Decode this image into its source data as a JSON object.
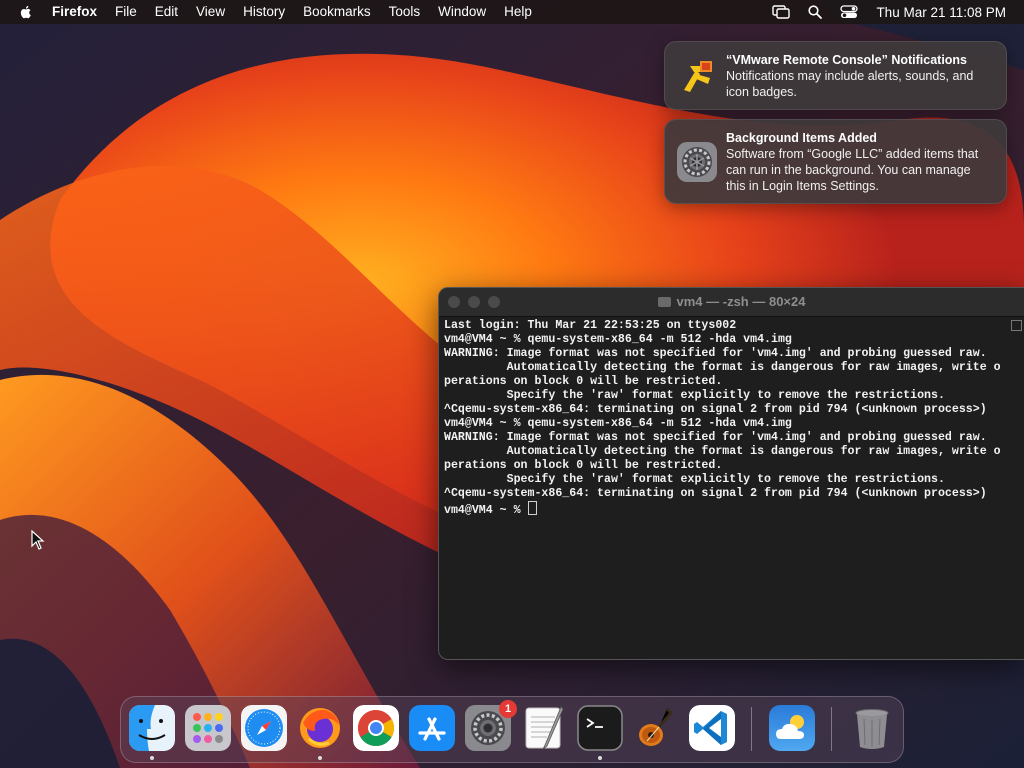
{
  "menubar": {
    "app_name": "Firefox",
    "items": [
      "File",
      "Edit",
      "View",
      "History",
      "Bookmarks",
      "Tools",
      "Window",
      "Help"
    ],
    "clock": "Thu Mar 21  11:08 PM",
    "status_icons": [
      "screen-mirroring-icon",
      "spotlight-search-icon",
      "control-center-icon"
    ]
  },
  "notifications": [
    {
      "title": "“VMware Remote Console” Notifications",
      "body": "Notifications may include alerts, sounds, and icon badges.",
      "icon": "vmware-remote-console-icon"
    },
    {
      "title": "Background Items Added",
      "body": "Software from “Google LLC” added items that can run in the background. You can manage this in Login Items Settings.",
      "icon": "system-settings-gear-icon"
    }
  ],
  "terminal": {
    "title": "vm4 — -zsh — 80×24",
    "lines": [
      "Last login: Thu Mar 21 22:53:25 on ttys002",
      "vm4@VM4 ~ % qemu-system-x86_64 -m 512 -hda vm4.img",
      "WARNING: Image format was not specified for 'vm4.img' and probing guessed raw.",
      "         Automatically detecting the format is dangerous for raw images, write o",
      "perations on block 0 will be restricted.",
      "         Specify the 'raw' format explicitly to remove the restrictions.",
      "^Cqemu-system-x86_64: terminating on signal 2 from pid 794 (<unknown process>)",
      "vm4@VM4 ~ % qemu-system-x86_64 -m 512 -hda vm4.img",
      "WARNING: Image format was not specified for 'vm4.img' and probing guessed raw.",
      "         Automatically detecting the format is dangerous for raw images, write o",
      "perations on block 0 will be restricted.",
      "         Specify the 'raw' format explicitly to remove the restrictions.",
      "^Cqemu-system-x86_64: terminating on signal 2 from pid 794 (<unknown process>)"
    ],
    "prompt": "vm4@VM4 ~ % "
  },
  "dock": {
    "apps": [
      {
        "name": "Finder",
        "icon": "finder-icon",
        "running": true
      },
      {
        "name": "Launchpad",
        "icon": "launchpad-icon",
        "running": false
      },
      {
        "name": "Safari",
        "icon": "safari-icon",
        "running": false
      },
      {
        "name": "Firefox",
        "icon": "firefox-icon",
        "running": true
      },
      {
        "name": "Google Chrome",
        "icon": "chrome-icon",
        "running": false
      },
      {
        "name": "App Store",
        "icon": "app-store-icon",
        "running": false
      },
      {
        "name": "System Settings",
        "icon": "system-settings-icon",
        "running": false,
        "badge": "1"
      },
      {
        "name": "TextEdit",
        "icon": "textedit-icon",
        "running": false
      },
      {
        "name": "Terminal",
        "icon": "terminal-icon",
        "running": true
      },
      {
        "name": "GarageBand",
        "icon": "garageband-icon",
        "running": false
      },
      {
        "name": "Visual Studio Code",
        "icon": "vscode-icon",
        "running": false
      },
      {
        "name": "Weather",
        "icon": "weather-icon",
        "running": false
      },
      {
        "name": "Trash",
        "icon": "trash-icon",
        "running": false
      }
    ]
  },
  "colors": {
    "menubar_bg": "#1c1614",
    "terminal_bg": "#1e1e1e",
    "notification_bg": "#3e3a3c",
    "wallpaper_orange": "#ff7a1a",
    "wallpaper_red": "#d42a1a",
    "wallpaper_navy": "#1a2238"
  }
}
